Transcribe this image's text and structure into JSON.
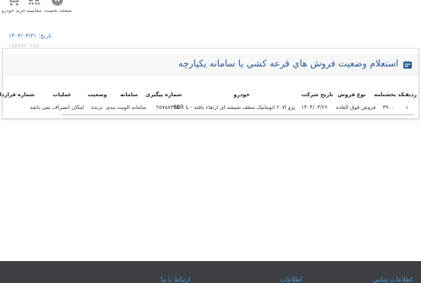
{
  "nav": {
    "home": "صفحه نخست",
    "compare": "مقایسه",
    "cart": "خرید خودرو"
  },
  "header": {
    "date_label": "تاریخ:",
    "date_value": "۱۴۰۴/۰۴/۳۱",
    "id_number": "۱۷۵۷۷۶۰۲۸۸"
  },
  "panel": {
    "title": "استعلام وضعیت فروش هاي قرعه كشي يا سامانه يكپارچه"
  },
  "table": {
    "columns": [
      "ردیف",
      "کد بخشنامه",
      "نوع فروش",
      "تاریخ شرکت",
      "خودرو",
      "شماره پیگیری",
      "سامانه",
      "وضعیت",
      "عملیات",
      "شماره قرارداد"
    ],
    "rows": [
      [
        "۱",
        "۴۹۰۰",
        "فروش فوق العاده",
        "۱۴۰۴/۰۴/۲۶",
        "پژو ۲۰۷i اتوماتیک سقف شیشه ای ارتقاء یافته - با SBR",
        "۲۵۷۸۸۳۳۵",
        "سامانه الویت بندی",
        "برنده",
        "امکان انصراف نمی باشد",
        ""
      ]
    ]
  },
  "footer": {
    "links": [
      "اطلاعات تماس",
      "اطلاعات",
      "ارتباط با ما"
    ]
  }
}
